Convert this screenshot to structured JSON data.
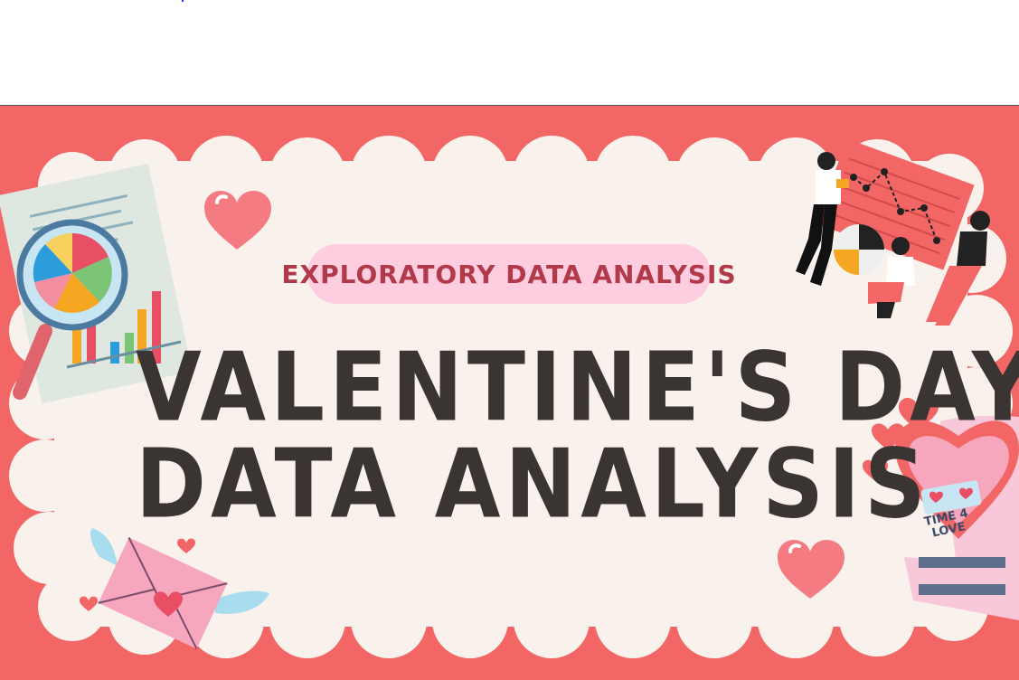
{
  "subtitle": "EXPLORATORY DATA ANALYSIS",
  "title_line1": "VALENTINE'S DAY",
  "title_line2": "DATA ANALYSIS",
  "watch_text": "TIME 4 LOVE",
  "colors": {
    "frame": "#f26666",
    "cloud": "#f9f1ec",
    "pill": "#fecde0",
    "subtitle_text": "#b13a4a",
    "title_text": "#3a3533",
    "heart": "#f47b82"
  },
  "icons": [
    "magnifier-report-icon",
    "heart-icon",
    "people-chart-icon",
    "love-letter-icon",
    "heart-watch-icon"
  ]
}
